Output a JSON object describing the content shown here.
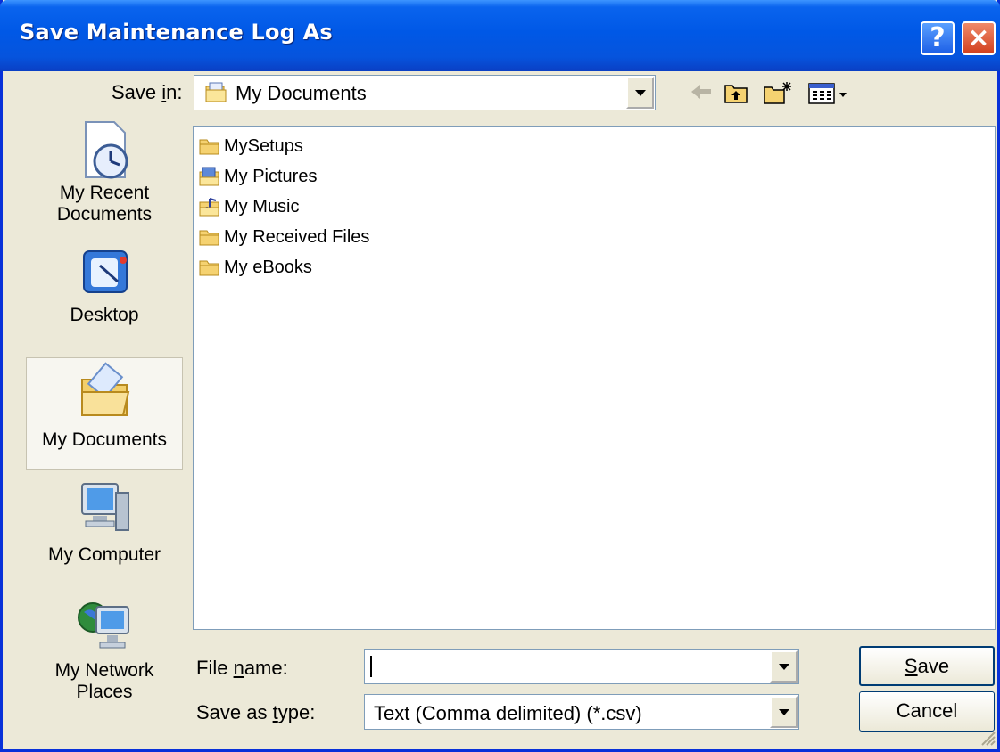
{
  "title": "Save Maintenance Log As",
  "titlebar": {
    "help": "?",
    "close": "×"
  },
  "save_in": {
    "label_pre": "Save ",
    "label_key": "i",
    "label_post": "n:",
    "value": "My Documents"
  },
  "places": [
    {
      "label1": "My Recent",
      "label2": "Documents"
    },
    {
      "label1": "Desktop"
    },
    {
      "label1": "My Documents"
    },
    {
      "label1": "My Computer"
    },
    {
      "label1": "My Network",
      "label2": "Places"
    }
  ],
  "files": [
    "MySetups",
    "My Pictures",
    "My Music",
    "My Received Files",
    "My eBooks"
  ],
  "file_name": {
    "label_pre": "File ",
    "label_key": "n",
    "label_post": "ame:",
    "value": ""
  },
  "save_type": {
    "label_pre": "Save as ",
    "label_key": "t",
    "label_post": "ype:",
    "value": "Text (Comma delimited) (*.csv)"
  },
  "buttons": {
    "save_key": "S",
    "save_rest": "ave",
    "cancel": "Cancel"
  }
}
